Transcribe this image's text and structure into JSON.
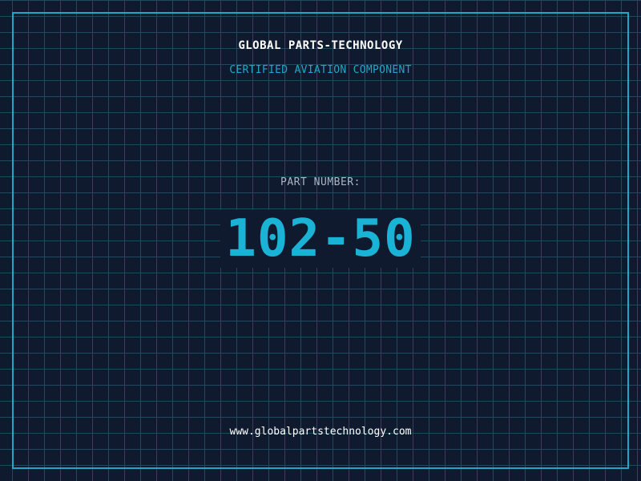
{
  "header": {
    "brand": "GLOBAL PARTS-TECHNOLOGY",
    "tagline": "CERTIFIED AVIATION COMPONENT"
  },
  "part": {
    "label": "PART NUMBER:",
    "number": "102-50"
  },
  "footer": {
    "website": "www.globalpartstechnology.com"
  },
  "colors": {
    "background": "#0f1a2e",
    "grid": "#1f4a5e",
    "accent": "#22a6c8",
    "part_number": "#1ab3d6",
    "label": "#a9b6c6",
    "text": "#ffffff"
  }
}
